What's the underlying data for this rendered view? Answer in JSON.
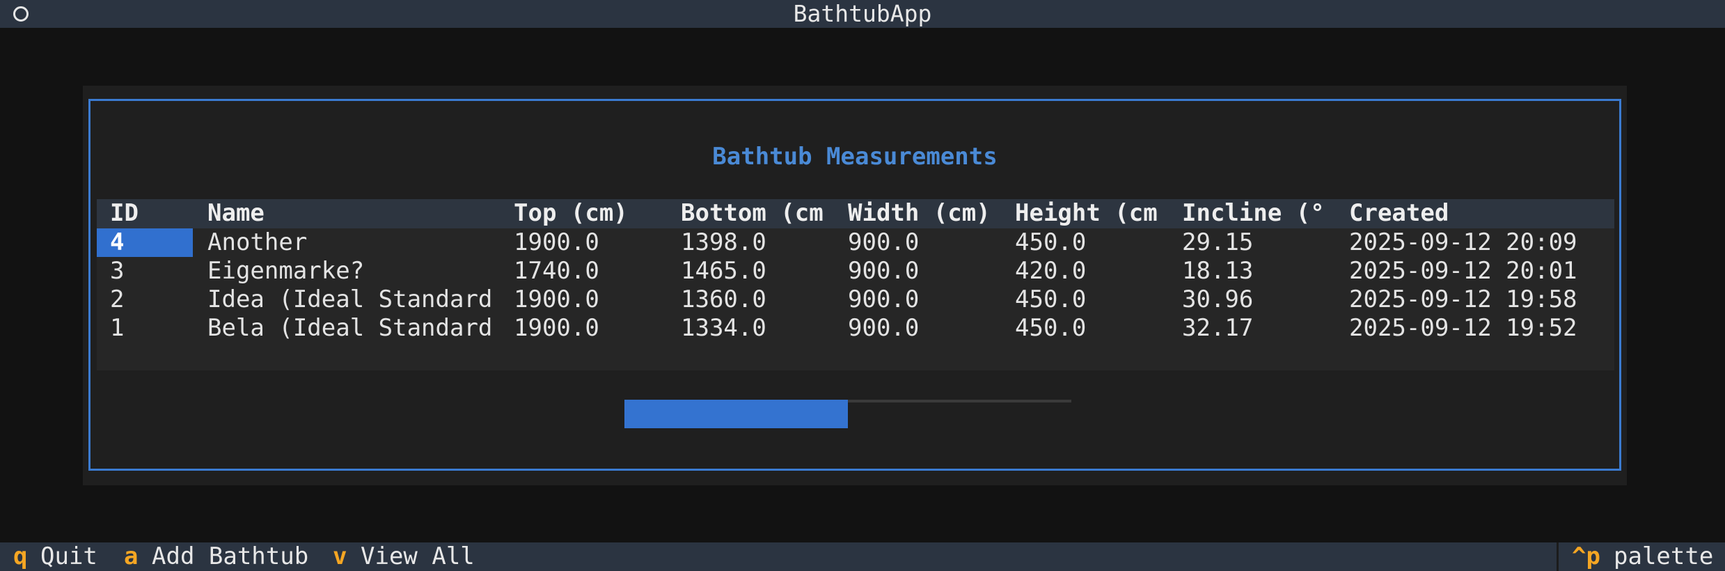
{
  "window": {
    "title": "BathtubApp"
  },
  "dialog": {
    "title": "Bathtub Measurements"
  },
  "table": {
    "columns": [
      "ID",
      "Name",
      "Top (cm)",
      "Bottom (cm",
      "Width (cm)",
      "Height (cm",
      "Incline (°",
      "Created"
    ],
    "rows": [
      [
        "4",
        "Another",
        "1900.0",
        "1398.0",
        "900.0",
        "450.0",
        "29.15",
        "2025-09-12 20:09"
      ],
      [
        "3",
        "Eigenmarke?",
        "1740.0",
        "1465.0",
        "900.0",
        "420.0",
        "18.13",
        "2025-09-12 20:01"
      ],
      [
        "2",
        "Idea (Ideal Standard",
        "1900.0",
        "1360.0",
        "900.0",
        "450.0",
        "30.96",
        "2025-09-12 19:58"
      ],
      [
        "1",
        "Bela (Ideal Standard",
        "1900.0",
        "1334.0",
        "900.0",
        "450.0",
        "32.17",
        "2025-09-12 19:52"
      ]
    ],
    "selected_row": 0
  },
  "progress": {
    "fraction": 0.5
  },
  "footer": {
    "bindings": [
      {
        "key": "q",
        "label": "Quit"
      },
      {
        "key": "a",
        "label": "Add Bathtub"
      },
      {
        "key": "v",
        "label": "View All"
      }
    ],
    "palette": {
      "key": "^p",
      "label": "palette"
    }
  },
  "colors": {
    "accent": "#3b7bd1",
    "title_bar": "#2b3441",
    "key_highlight": "#f5a623",
    "selection": "#3170cf"
  }
}
